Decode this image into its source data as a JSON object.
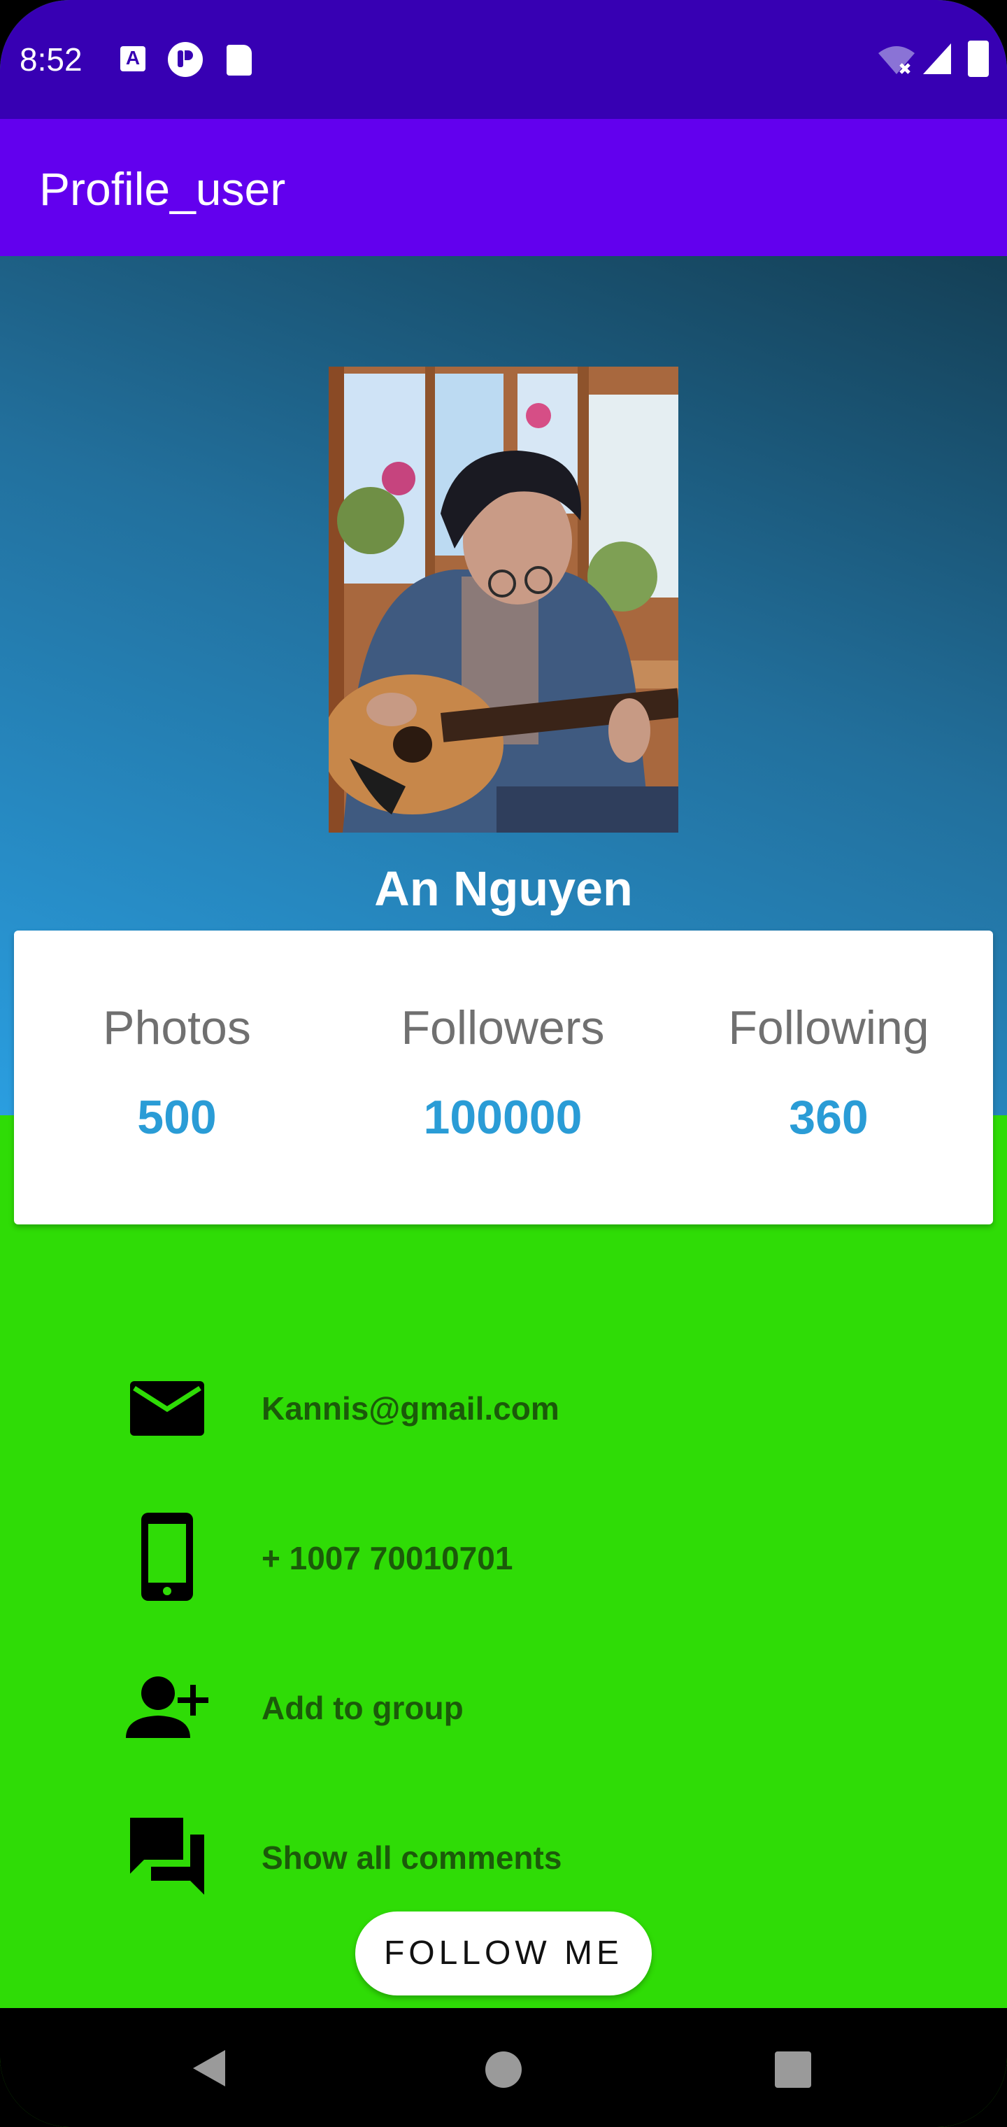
{
  "status_bar": {
    "time": "8:52",
    "icons": [
      "notification-a-icon",
      "data-saver-icon",
      "sd-card-icon",
      "wifi-off-icon",
      "signal-icon",
      "battery-icon"
    ]
  },
  "app_bar": {
    "title": "Profile_user"
  },
  "profile": {
    "name": "An Nguyen",
    "photo_description": "profile-photo"
  },
  "stats": [
    {
      "label": "Photos",
      "value": "500"
    },
    {
      "label": "Followers",
      "value": "100000"
    },
    {
      "label": "Following",
      "value": "360"
    }
  ],
  "contacts": [
    {
      "icon": "email-icon",
      "text": "Kannis@gmail.com"
    },
    {
      "icon": "phone-icon",
      "text": "+ 1007 70010701"
    },
    {
      "icon": "add-person-icon",
      "text": "Add to group"
    },
    {
      "icon": "comments-icon",
      "text": "Show all comments"
    }
  ],
  "follow_button": {
    "label": "FOLLOW ME"
  },
  "nav_bar": {
    "buttons": [
      "back",
      "home",
      "recents"
    ]
  },
  "colors": {
    "status_bar": "#3700b3",
    "app_bar": "#6200ee",
    "background": "#2fdc06",
    "accent": "#2a9cd6",
    "contact_text": "#1b5a0a"
  }
}
